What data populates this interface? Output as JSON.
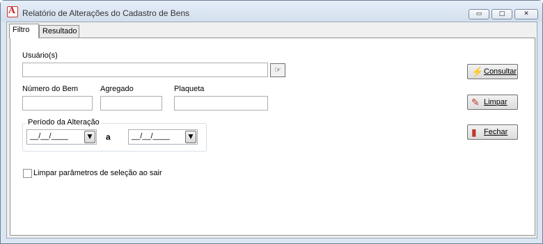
{
  "window": {
    "title": "Relatório de Alterações do Cadastro de Bens",
    "min_glyph": "▭",
    "max_glyph": "□",
    "close_glyph": "✕",
    "app_icon_glyph": "A"
  },
  "tabs": [
    {
      "label": "Filtro",
      "active": true
    },
    {
      "label": "Resultado",
      "active": false
    }
  ],
  "filter": {
    "users_label": "Usuário(s)",
    "users_value": "",
    "lookup_glyph": "☞",
    "bem_label": "Número do Bem",
    "bem_value": "",
    "agregado_label": "Agregado",
    "agregado_value": "",
    "plaqueta_label": "Plaqueta",
    "plaqueta_value": "",
    "periodo_caption": "Período da Alteração",
    "date_from": "__/__/____",
    "date_sep": "a",
    "date_to": "__/__/____",
    "dropdown_glyph": "▼",
    "clear_on_exit_label": "Limpar parâmetros de seleção ao sair",
    "clear_on_exit_checked": false
  },
  "actions": {
    "consultar": {
      "label": "Consultar",
      "icon": "lightning-icon",
      "glyph": "⚡"
    },
    "limpar": {
      "label": "Limpar",
      "icon": "eraser-icon",
      "glyph": "✎"
    },
    "fechar": {
      "label": "Fechar",
      "icon": "door-icon",
      "glyph": "▮"
    }
  }
}
